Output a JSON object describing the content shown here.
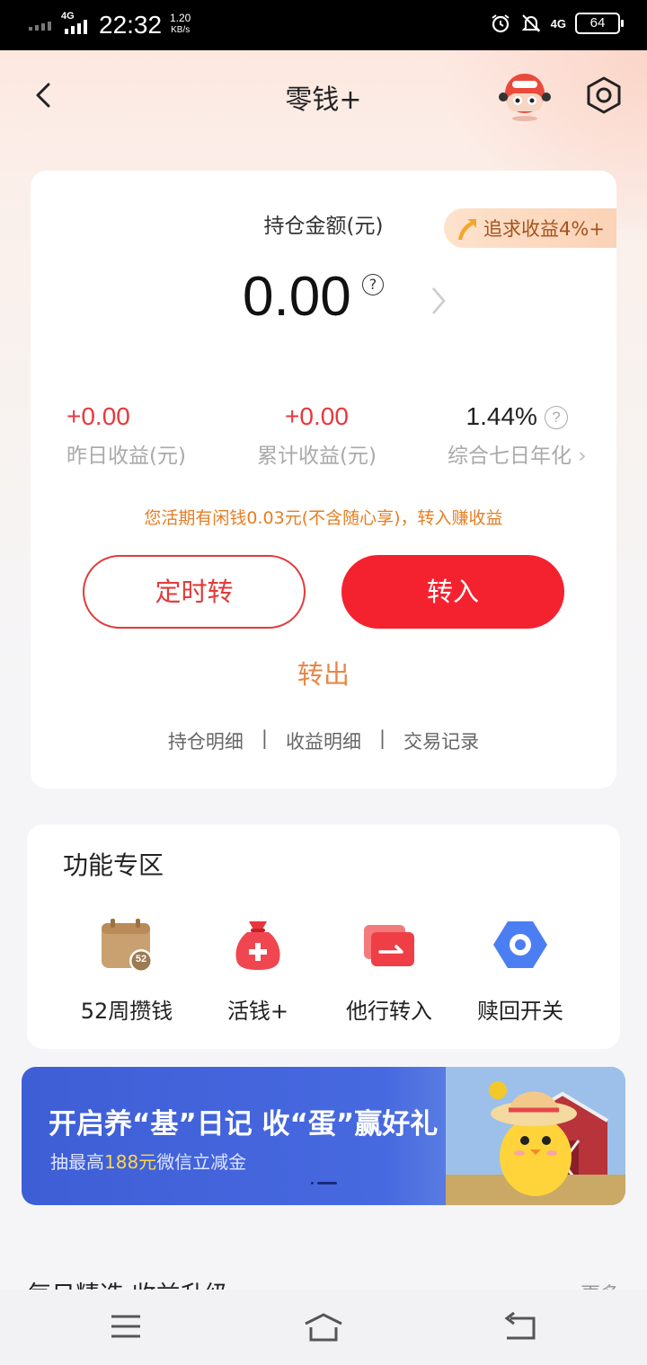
{
  "status_bar": {
    "network": "4G",
    "time": "22:32",
    "speed_value": "1.20",
    "speed_unit": "KB/s",
    "sim2_label": "4G",
    "battery": "64"
  },
  "header": {
    "title": "零钱+"
  },
  "holding": {
    "label": "持仓金额(元)",
    "amount": "0.00",
    "help": "?",
    "promo": "追求收益4%+"
  },
  "stats": [
    {
      "value": "+0.00",
      "label": "昨日收益(元)"
    },
    {
      "value": "+0.00",
      "label": "累计收益(元)"
    },
    {
      "value": "1.44%",
      "label": "综合七日年化"
    }
  ],
  "idle_tip": "您活期有闲钱0.03元(不含随心享)，转入赚收益",
  "buttons": {
    "timer": "定时转",
    "transfer_in": "转入",
    "transfer_out": "转出"
  },
  "links": {
    "holdings": "持仓明细",
    "separator": "|",
    "earnings": "收益明细",
    "transactions": "交易记录"
  },
  "functions": {
    "title": "功能专区",
    "items": [
      {
        "label": "52周攒钱",
        "icon": "calendar-52-icon",
        "badge": "52"
      },
      {
        "label": "活钱+",
        "icon": "money-bag-plus-icon"
      },
      {
        "label": "他行转入",
        "icon": "card-transfer-icon"
      },
      {
        "label": "赎回开关",
        "icon": "hexagon-toggle-icon"
      }
    ]
  },
  "banner": {
    "title": "开启养“基”日记 收“蛋”赢好礼",
    "sub_prefix": "抽最高",
    "sub_highlight": "188元",
    "sub_suffix": "微信立减金"
  },
  "daily": {
    "title": "每日精选 收益升级",
    "more": "更多"
  },
  "colors": {
    "primary_red": "#f4222f",
    "profit_red": "#e8383d",
    "orange_tip": "#e67e22",
    "banner_blue": "#4769e0"
  }
}
